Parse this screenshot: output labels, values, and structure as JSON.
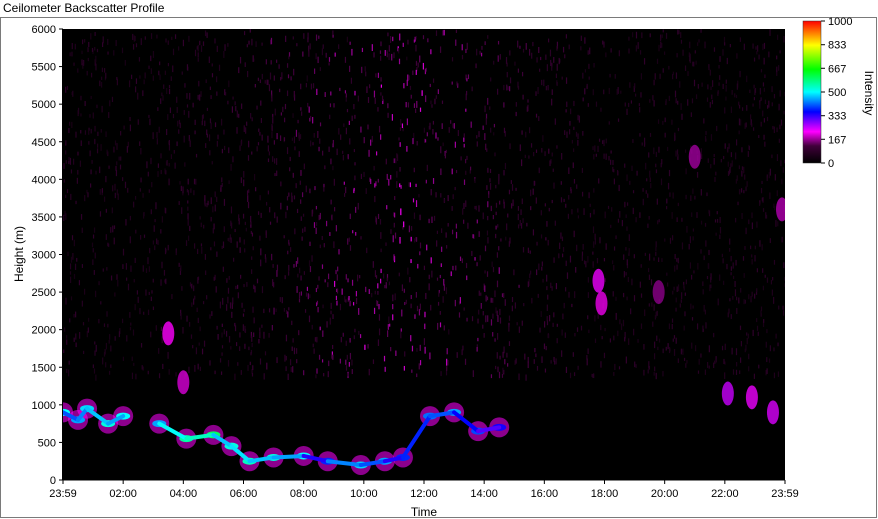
{
  "window_title": "Ceilometer Backscatter Profile",
  "chart_data": {
    "type": "heatmap",
    "title": "Ceilometer Backscatter Profile",
    "xlabel": "Time",
    "ylabel": "Height (m)",
    "colorbar_label": "Intensity",
    "x_ticks": [
      "23:59",
      "02:00",
      "04:00",
      "06:00",
      "08:00",
      "10:00",
      "12:00",
      "14:00",
      "16:00",
      "18:00",
      "20:00",
      "22:00",
      "23:59"
    ],
    "y_ticks": [
      "0",
      "500",
      "1000",
      "1500",
      "2000",
      "2500",
      "3000",
      "3500",
      "4000",
      "4500",
      "5000",
      "5500",
      "6000"
    ],
    "ylim": [
      0,
      6000
    ],
    "colorbar_ticks": [
      "0",
      "167",
      "333",
      "500",
      "667",
      "833",
      "1000"
    ],
    "colorbar_range": [
      0,
      1000
    ],
    "colormap": [
      "#000000",
      "#ff00ff",
      "#0000ff",
      "#00ffff",
      "#00ff00",
      "#ffff00",
      "#ff0000"
    ],
    "features": {
      "cloud_base_layer": [
        {
          "hours": 0.0,
          "height_m": 900,
          "intensity": 500
        },
        {
          "hours": 0.5,
          "height_m": 800,
          "intensity": 450
        },
        {
          "hours": 0.8,
          "height_m": 950,
          "intensity": 480
        },
        {
          "hours": 1.5,
          "height_m": 750,
          "intensity": 520
        },
        {
          "hours": 2.0,
          "height_m": 850,
          "intensity": 500
        },
        {
          "hours": 3.2,
          "height_m": 750,
          "intensity": 450
        },
        {
          "hours": 4.1,
          "height_m": 550,
          "intensity": 560
        },
        {
          "hours": 5.0,
          "height_m": 600,
          "intensity": 600
        },
        {
          "hours": 5.6,
          "height_m": 450,
          "intensity": 520
        },
        {
          "hours": 6.2,
          "height_m": 250,
          "intensity": 540
        },
        {
          "hours": 7.0,
          "height_m": 300,
          "intensity": 520
        },
        {
          "hours": 8.0,
          "height_m": 320,
          "intensity": 500
        },
        {
          "hours": 8.8,
          "height_m": 250,
          "intensity": 380
        },
        {
          "hours": 9.9,
          "height_m": 200,
          "intensity": 480
        },
        {
          "hours": 10.7,
          "height_m": 250,
          "intensity": 450
        },
        {
          "hours": 11.3,
          "height_m": 300,
          "intensity": 380
        },
        {
          "hours": 12.2,
          "height_m": 850,
          "intensity": 420
        },
        {
          "hours": 13.0,
          "height_m": 900,
          "intensity": 450
        },
        {
          "hours": 13.8,
          "height_m": 650,
          "intensity": 400
        },
        {
          "hours": 14.5,
          "height_m": 700,
          "intensity": 350
        }
      ],
      "faint_patches": [
        {
          "hours": 3.5,
          "height_m": 1950,
          "intensity": 220
        },
        {
          "hours": 4.0,
          "height_m": 1300,
          "intensity": 200
        },
        {
          "hours": 17.8,
          "height_m": 2650,
          "intensity": 230
        },
        {
          "hours": 17.9,
          "height_m": 2350,
          "intensity": 210
        },
        {
          "hours": 19.8,
          "height_m": 2500,
          "intensity": 160
        },
        {
          "hours": 21.0,
          "height_m": 4300,
          "intensity": 170
        },
        {
          "hours": 22.1,
          "height_m": 1150,
          "intensity": 250
        },
        {
          "hours": 22.9,
          "height_m": 1100,
          "intensity": 230
        },
        {
          "hours": 23.6,
          "height_m": 900,
          "intensity": 240
        },
        {
          "hours": 23.9,
          "height_m": 3600,
          "intensity": 180
        }
      ]
    }
  }
}
